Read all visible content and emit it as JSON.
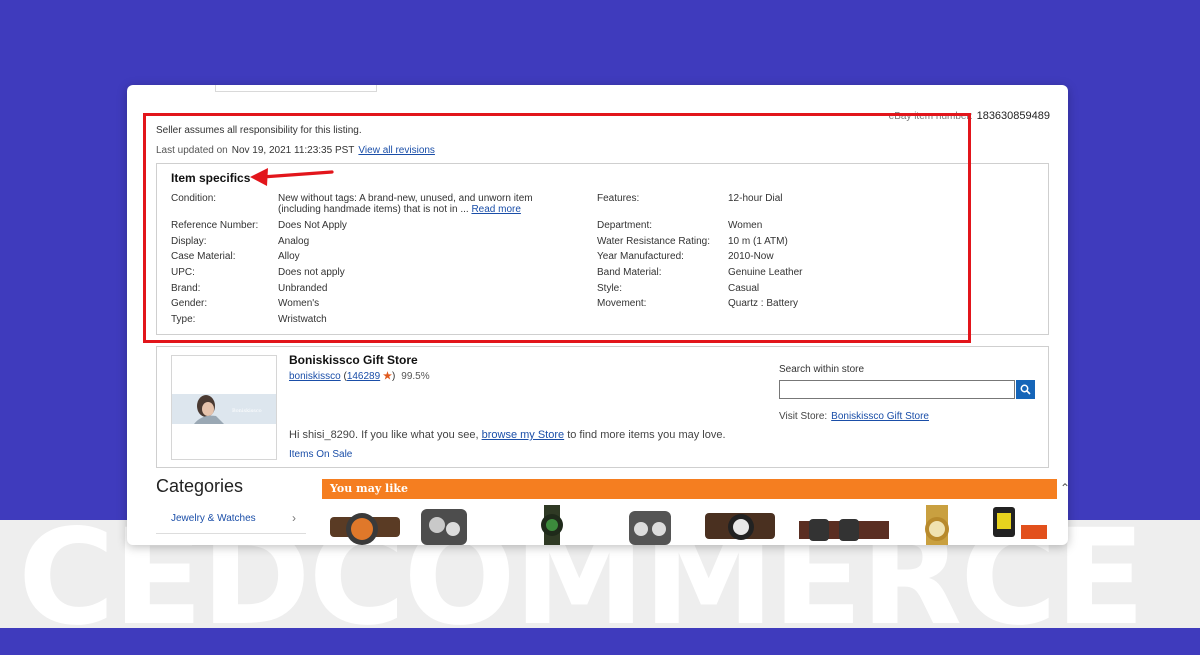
{
  "header": {
    "item_number_label": "eBay item number:",
    "item_number": "183630859489"
  },
  "listing": {
    "responsibility_text": "Seller assumes all responsibility for this listing.",
    "last_updated_label": "Last updated on",
    "last_updated_date": "Nov 19, 2021 11:23:35 PST",
    "view_revisions_link": "View all revisions"
  },
  "specifics": {
    "title": "Item specifics",
    "left": [
      {
        "label": "Condition:",
        "value": "New without tags: A brand-new, unused, and unworn item",
        "value2": "(including handmade items) that is not in ...",
        "link": "Read more"
      },
      {
        "label": "Reference Number:",
        "value": "Does Not Apply"
      },
      {
        "label": "Display:",
        "value": "Analog"
      },
      {
        "label": "Case Material:",
        "value": "Alloy"
      },
      {
        "label": "UPC:",
        "value": "Does not apply"
      },
      {
        "label": "Brand:",
        "value": "Unbranded"
      },
      {
        "label": "Gender:",
        "value": "Women's"
      },
      {
        "label": "Type:",
        "value": "Wristwatch"
      }
    ],
    "right": [
      {
        "label": "Features:",
        "value": "12-hour Dial"
      },
      {
        "label": "Department:",
        "value": "Women"
      },
      {
        "label": "Water Resistance Rating:",
        "value": "10 m (1 ATM)"
      },
      {
        "label": "Year Manufactured:",
        "value": "2010-Now"
      },
      {
        "label": "Band Material:",
        "value": "Genuine Leather"
      },
      {
        "label": "Style:",
        "value": "Casual"
      },
      {
        "label": "Movement:",
        "value": "Quartz : Battery"
      }
    ]
  },
  "store": {
    "name": "Boniskissco Gift Store",
    "seller_id": "boniskissco",
    "feedback_count": "146289",
    "feedback_pct": "99.5%",
    "greeting_prefix": "Hi shisi_8290. If you like what you see,",
    "greeting_link": "browse my Store",
    "greeting_suffix": "to find more items you may love.",
    "on_sale_link": "Items On Sale",
    "search_label": "Search within store",
    "visit_label": "Visit Store:",
    "visit_link": "Boniskissco Gift Store",
    "thumb_text": "Boniskissco"
  },
  "categories": {
    "title": "Categories",
    "items": [
      "Jewelry & Watches"
    ]
  },
  "you_may_like": {
    "title": "You may like"
  },
  "watermark": "CEDCOMMERCE",
  "colors": {
    "background": "#3f3bbd",
    "highlight": "#e2151b",
    "link": "#1a4ea8",
    "banner": "#f57e20",
    "search_button": "#1565b8"
  }
}
